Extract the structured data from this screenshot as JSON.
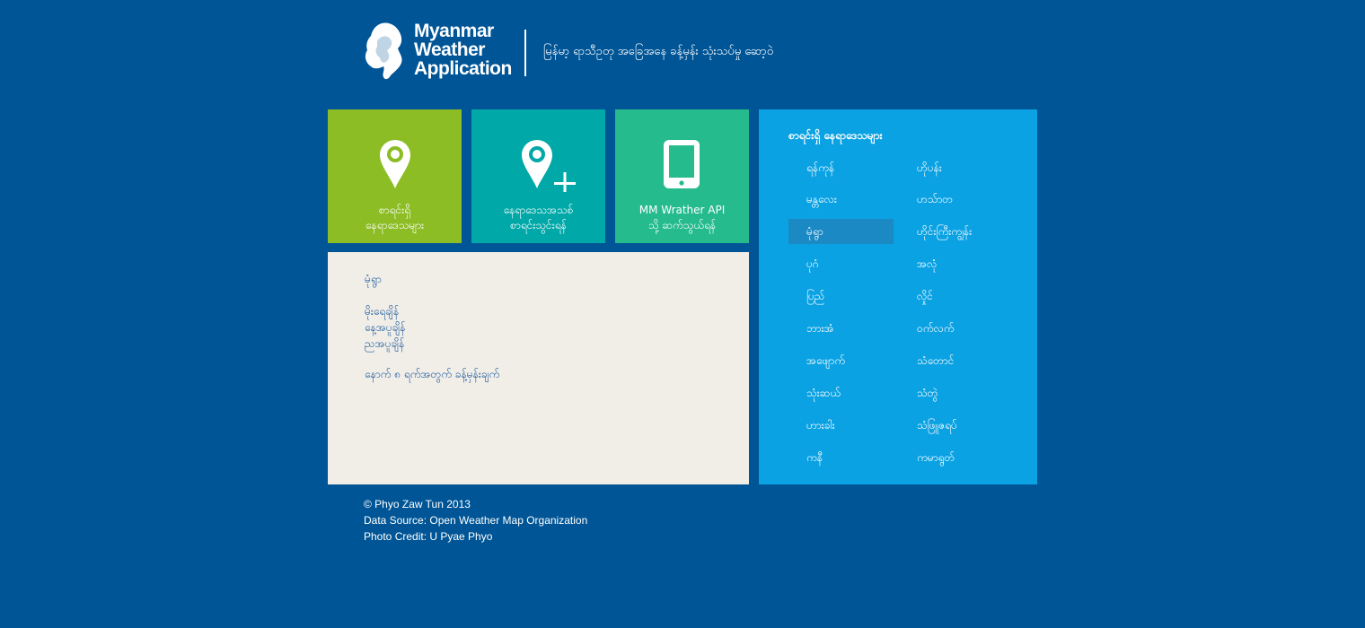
{
  "header": {
    "logo_lines": [
      "Myanmar",
      "Weather",
      "Application"
    ],
    "tagline": "မြန်မာ့ ရာသီဥတု အခြေအနေ ခန့်မှန်း သုံးသပ်မှု ဆော့ဝဲ"
  },
  "tiles": [
    {
      "icon": "location-pin-icon",
      "line1": "စာရင်းရှိ",
      "line2": "နေရာဒေသများ"
    },
    {
      "icon": "add-location-icon",
      "line1": "နေရာဒေသအသစ်",
      "line2": "စာရင်းသွင်းရန်"
    },
    {
      "icon": "tablet-icon",
      "line1": "MM Wrather API",
      "line2": "သို့ ဆက်သွယ်ရန်"
    }
  ],
  "detail": {
    "city": "မုံရွာ",
    "links": [
      "မိုးရေချိန်",
      "နေ့အပူချိန်",
      "ညအပူချိန်"
    ],
    "forecast": "နောက် ၈ ရက်အတွက် ခန့်မှန်းချက်"
  },
  "cities": {
    "heading": "စာရင်းရှိ နေရာဒေသများ",
    "left": [
      "ရန်ကုန်",
      "မန္တလေး",
      "မုံရွာ",
      "ပုဂံ",
      "ပြည်",
      "ဘားအံ",
      "အဖျောက်",
      "သုံးဆယ်",
      "ဟားခါး",
      "ကနီ"
    ],
    "right": [
      "ဟိုပန်း",
      "ဟသ်ာတ",
      "ဟိုင်းကြီးကျွန်း",
      "အလုံ",
      "လှိုင်",
      "ဝက်လက်",
      "သံတောင်",
      "သံတွဲ",
      "သံဖြူဇရပ်",
      "ကမာရွတ်"
    ],
    "selected": "မုံရွာ"
  },
  "footer": {
    "copyright": "© Phyo Zaw Tun 2013",
    "data_source": "Data Source: Open Weather Map Organization",
    "photo_credit": "Photo Credit: U Pyae Phyo"
  },
  "colors": {
    "background": "#005596",
    "tile_green": "#8cbd25",
    "tile_teal": "#00a8a8",
    "tile_mint": "#25bb8c",
    "panel_light": "#f1eee8",
    "panel_blue": "#0aa2e3",
    "selected_row": "#1a89c4"
  }
}
